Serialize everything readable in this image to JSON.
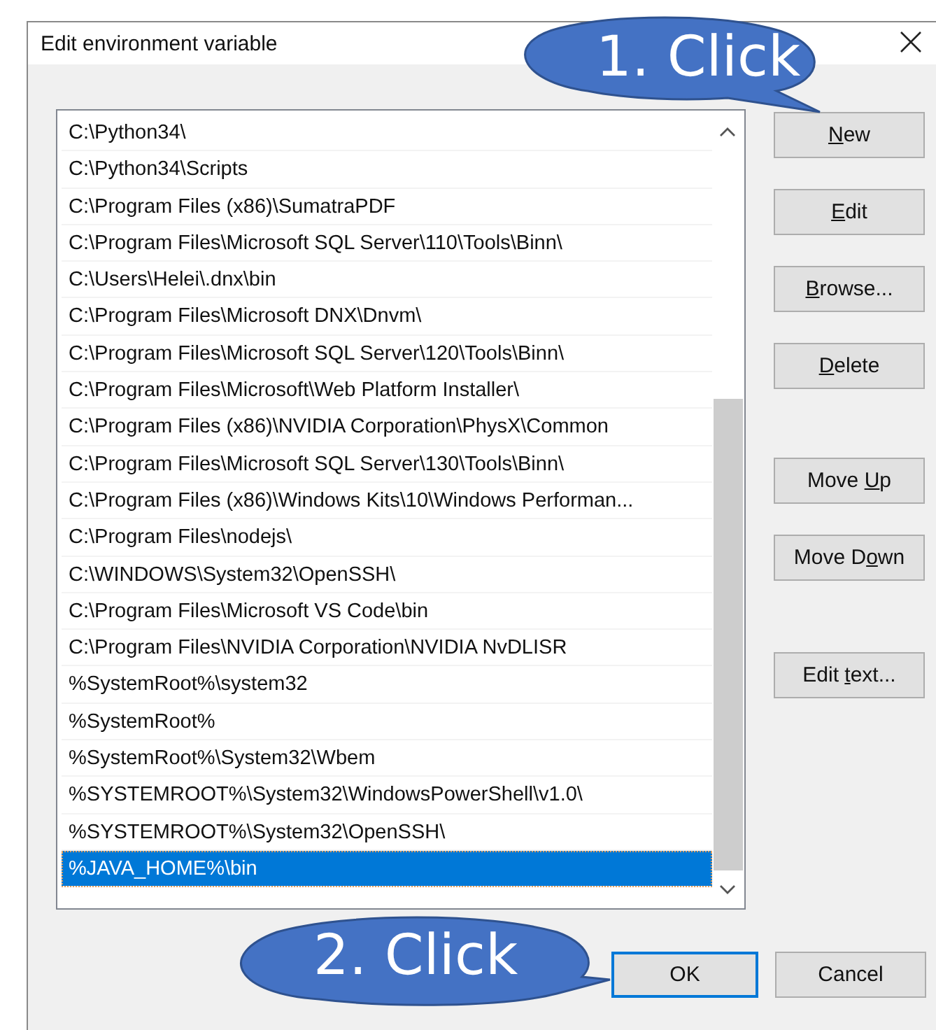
{
  "window": {
    "title": "Edit environment variable"
  },
  "paths": [
    {
      "text": "C:\\Python34\\",
      "selected": false
    },
    {
      "text": "C:\\Python34\\Scripts",
      "selected": false
    },
    {
      "text": "C:\\Program Files (x86)\\SumatraPDF",
      "selected": false
    },
    {
      "text": "C:\\Program Files\\Microsoft SQL Server\\110\\Tools\\Binn\\",
      "selected": false
    },
    {
      "text": "C:\\Users\\Helei\\.dnx\\bin",
      "selected": false
    },
    {
      "text": "C:\\Program Files\\Microsoft DNX\\Dnvm\\",
      "selected": false
    },
    {
      "text": "C:\\Program Files\\Microsoft SQL Server\\120\\Tools\\Binn\\",
      "selected": false
    },
    {
      "text": "C:\\Program Files\\Microsoft\\Web Platform Installer\\",
      "selected": false
    },
    {
      "text": "C:\\Program Files (x86)\\NVIDIA Corporation\\PhysX\\Common",
      "selected": false
    },
    {
      "text": "C:\\Program Files\\Microsoft SQL Server\\130\\Tools\\Binn\\",
      "selected": false
    },
    {
      "text": "C:\\Program Files (x86)\\Windows Kits\\10\\Windows Performan...",
      "selected": false
    },
    {
      "text": "C:\\Program Files\\nodejs\\",
      "selected": false
    },
    {
      "text": "C:\\WINDOWS\\System32\\OpenSSH\\",
      "selected": false
    },
    {
      "text": "C:\\Program Files\\Microsoft VS Code\\bin",
      "selected": false
    },
    {
      "text": "C:\\Program Files\\NVIDIA Corporation\\NVIDIA NvDLISR",
      "selected": false
    },
    {
      "text": "%SystemRoot%\\system32",
      "selected": false
    },
    {
      "text": "%SystemRoot%",
      "selected": false
    },
    {
      "text": "%SystemRoot%\\System32\\Wbem",
      "selected": false
    },
    {
      "text": "%SYSTEMROOT%\\System32\\WindowsPowerShell\\v1.0\\",
      "selected": false
    },
    {
      "text": "%SYSTEMROOT%\\System32\\OpenSSH\\",
      "selected": false
    },
    {
      "text": "%JAVA_HOME%\\bin",
      "selected": true
    }
  ],
  "side_buttons": [
    {
      "key": "N",
      "after": "ew"
    },
    {
      "key": "E",
      "after": "dit"
    },
    {
      "key": "B",
      "after": "rowse..."
    },
    {
      "key": "D",
      "after": "elete"
    },
    {
      "before": "Move ",
      "key": "U",
      "after": "p"
    },
    {
      "before": "Move D",
      "key": "o",
      "after": "wn"
    },
    {
      "before": "Edit ",
      "key": "t",
      "after": "ext..."
    }
  ],
  "footer_buttons": [
    {
      "label": "OK",
      "default": true
    },
    {
      "label": "Cancel",
      "default": false
    }
  ],
  "callouts": [
    {
      "text": "1. Click"
    },
    {
      "text": "2. Click"
    }
  ]
}
